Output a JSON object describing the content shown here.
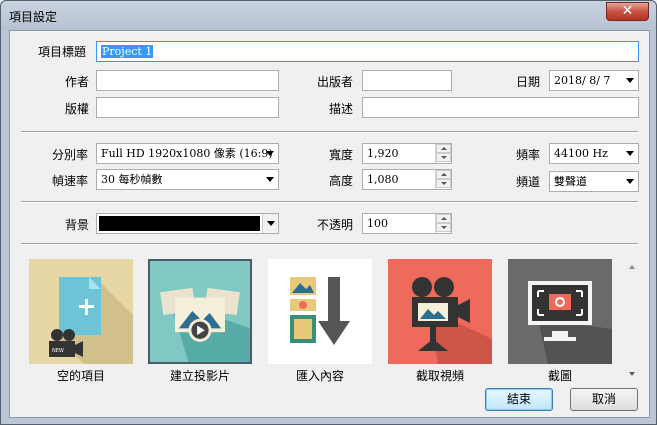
{
  "window": {
    "title": "項目設定",
    "close_label": "✕"
  },
  "form": {
    "project_title_label": "項目標題",
    "project_title_value": "Project 1",
    "author_label": "作者",
    "author_value": "",
    "publisher_label": "出版者",
    "publisher_value": "",
    "date_label": "日期",
    "date_value": "2018/ 8/ 7",
    "copyright_label": "版權",
    "copyright_value": "",
    "description_label": "描述",
    "description_value": ""
  },
  "video": {
    "resolution_label": "分別率",
    "resolution_value": "Full HD 1920x1080 像素 (16:9)",
    "framerate_label": "幀速率",
    "framerate_value": "30 每秒幀數",
    "width_label": "寬度",
    "width_value": "1,920",
    "height_label": "高度",
    "height_value": "1,080",
    "samplerate_label": "頻率",
    "samplerate_value": "44100 Hz",
    "channel_label": "頻道",
    "channel_value": "雙聲道"
  },
  "background": {
    "bg_label": "背景",
    "bg_color": "#000000",
    "opacity_label": "不透明",
    "opacity_value": "100"
  },
  "tiles": [
    {
      "label": "空的項目",
      "icon": "film-camera-new-icon",
      "bg": "#e7d7a4"
    },
    {
      "label": "建立投影片",
      "icon": "slideshow-play-icon",
      "bg": "#7fc8c4"
    },
    {
      "label": "匯入內容",
      "icon": "import-media-icon",
      "bg": "#ffffff"
    },
    {
      "label": "截取視頻",
      "icon": "video-camera-icon",
      "bg": "#ee6a5b"
    },
    {
      "label": "截圖",
      "icon": "screenshot-icon",
      "bg": "#6a6a6a"
    }
  ],
  "buttons": {
    "ok_label": "結束",
    "cancel_label": "取消"
  }
}
